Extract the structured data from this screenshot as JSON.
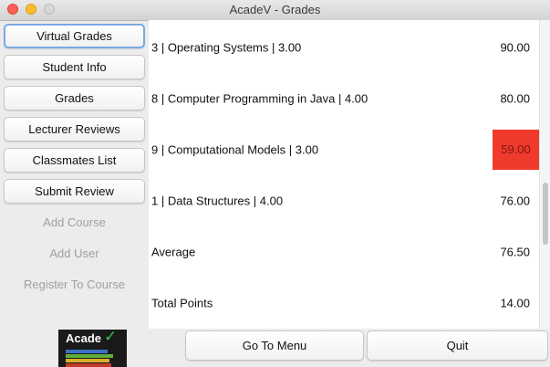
{
  "window": {
    "title": "AcadeV - Grades"
  },
  "sidebar": {
    "items": [
      {
        "label": "Virtual Grades",
        "state": "active"
      },
      {
        "label": "Student Info",
        "state": "enabled"
      },
      {
        "label": "Grades",
        "state": "enabled"
      },
      {
        "label": "Lecturer Reviews",
        "state": "enabled"
      },
      {
        "label": "Classmates List",
        "state": "enabled"
      },
      {
        "label": "Submit Review",
        "state": "enabled"
      },
      {
        "label": "Add Course",
        "state": "disabled"
      },
      {
        "label": "Add User",
        "state": "disabled"
      },
      {
        "label": "Register To Course",
        "state": "disabled"
      }
    ]
  },
  "logo": {
    "text": "Acade",
    "check": "✓"
  },
  "grades": {
    "rows": [
      {
        "label": "3 | Operating Systems | 3.00",
        "value": "90.00",
        "highlight": false
      },
      {
        "label": "8 | Computer Programming in Java | 4.00",
        "value": "80.00",
        "highlight": false
      },
      {
        "label": "9 | Computational Models | 3.00",
        "value": "59.00",
        "highlight": true
      },
      {
        "label": "1 | Data Structures | 4.00",
        "value": "76.00",
        "highlight": false
      },
      {
        "label": "Average",
        "value": "76.50",
        "highlight": false
      },
      {
        "label": "Total Points",
        "value": "14.00",
        "highlight": false
      }
    ],
    "highlight_color": "#f03a2c"
  },
  "footer": {
    "menu_label": "Go To Menu",
    "quit_label": "Quit"
  }
}
